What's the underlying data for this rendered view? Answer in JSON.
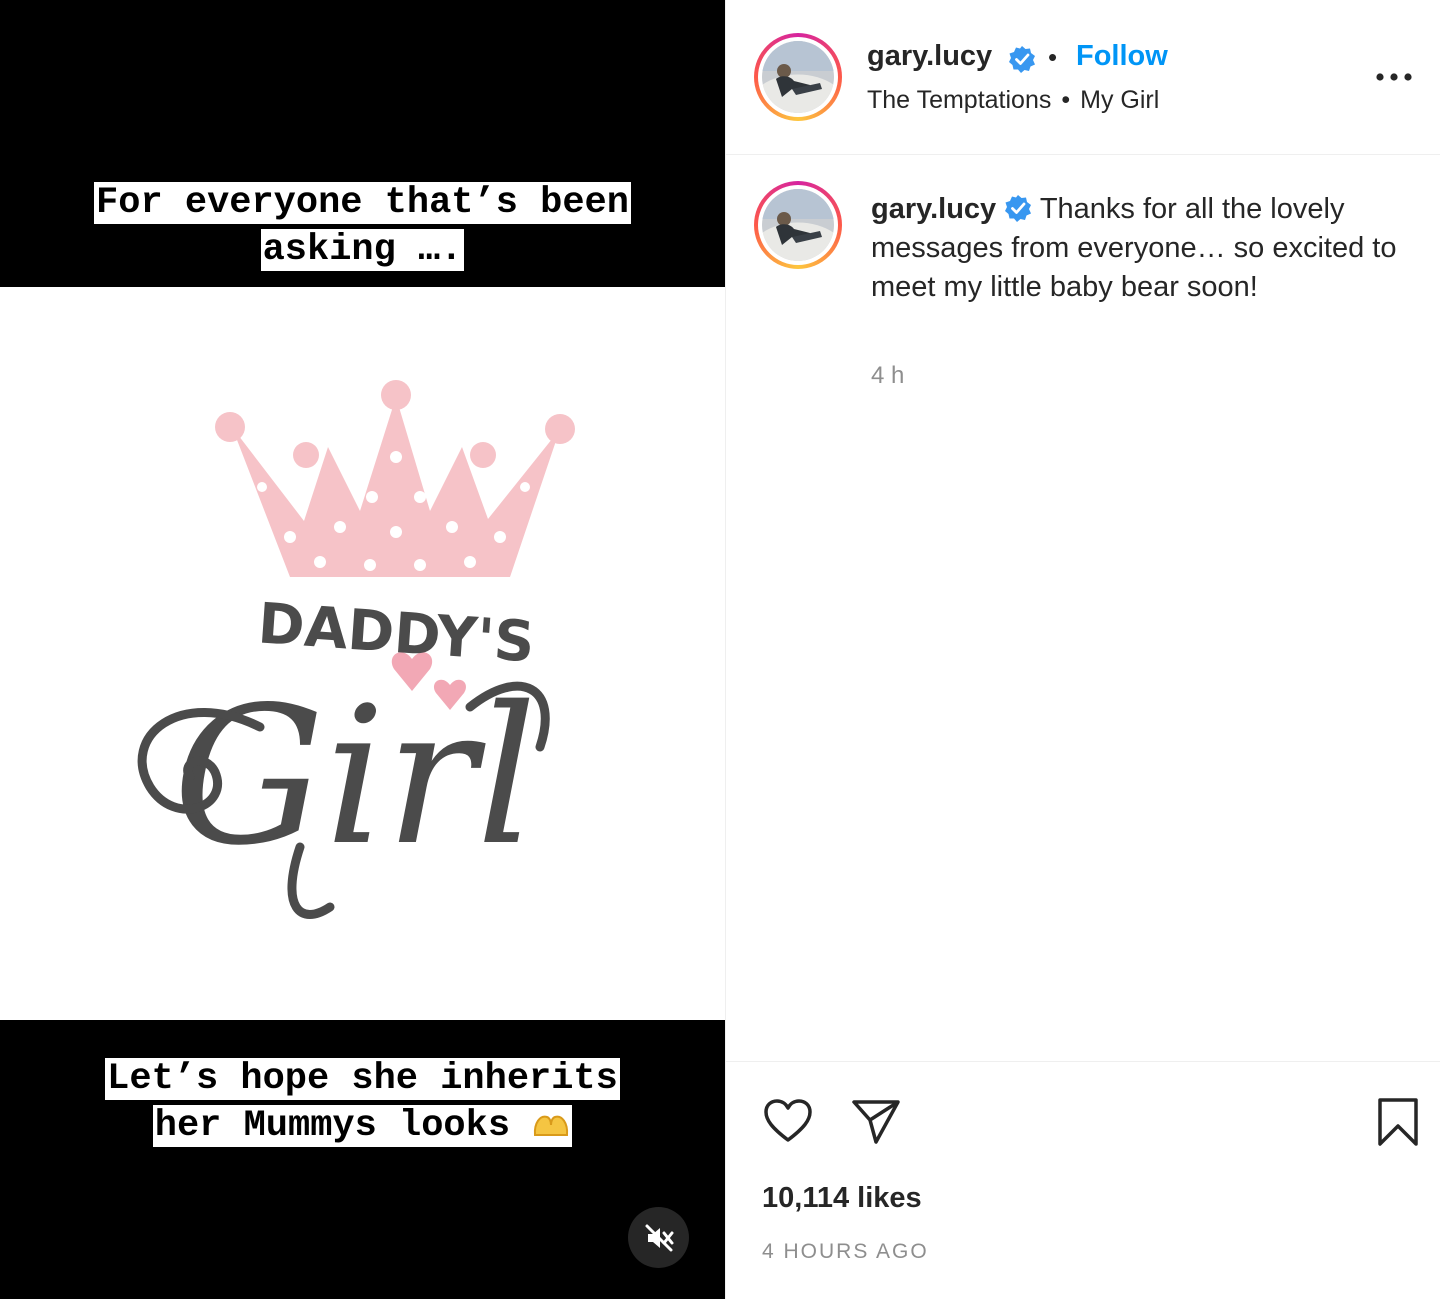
{
  "media": {
    "caption_top": [
      "For everyone that’s been",
      "asking …."
    ],
    "caption_bottom": [
      "Let’s hope she inherits",
      "her Mummys looks "
    ],
    "graphic": {
      "word_top": "DADDY'S",
      "word_main": "Girl",
      "crown_color": "#f6c3c8",
      "text_color": "#4b4b4b"
    },
    "mute_icon": "speaker-muted-icon"
  },
  "header": {
    "username": "gary.lucy",
    "verified_icon": "verified-badge-icon",
    "follow_label": "Follow",
    "audio_artist": "The Temptations",
    "audio_track": "My Girl",
    "more_icon": "more-options-icon"
  },
  "caption": {
    "username": "gary.lucy",
    "text": "Thanks for all the lovely messages from everyone… so excited to meet my little baby bear soon!",
    "time": "4 h"
  },
  "actions": {
    "like_icon": "heart-icon",
    "share_icon": "paper-plane-icon",
    "save_icon": "bookmark-icon"
  },
  "stats": {
    "likes": "10,114 likes",
    "age": "4 HOURS AGO"
  },
  "colors": {
    "accent": "#0095f6",
    "verified": "#3897f0",
    "muted_text": "#8e8e8e"
  }
}
